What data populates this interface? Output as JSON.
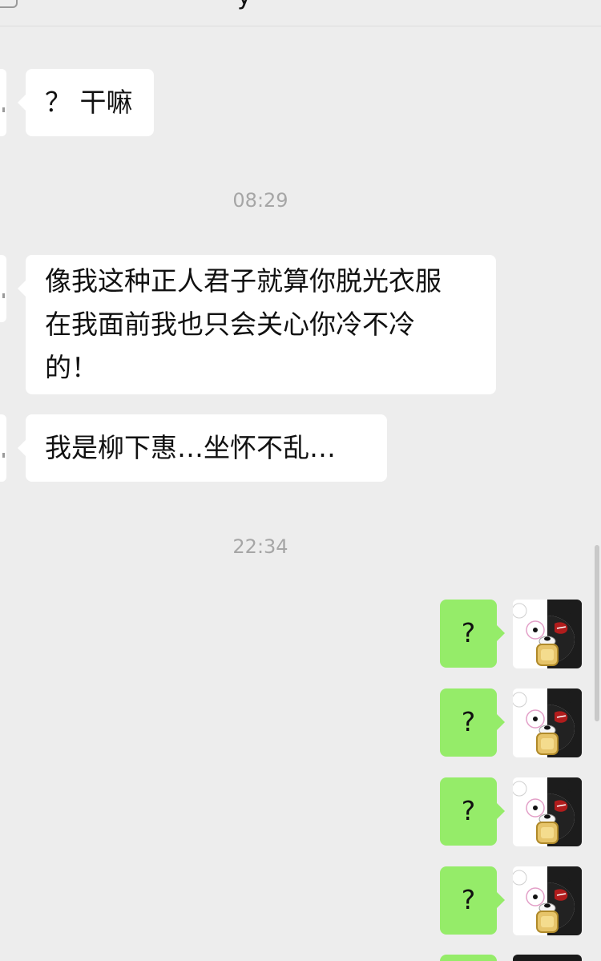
{
  "header": {
    "title_fragment": "y"
  },
  "messages": [
    {
      "side": "left",
      "text": "？ 干嘛"
    },
    {
      "type": "time",
      "text": "08:29"
    },
    {
      "side": "left",
      "lines": [
        "像我这种正人君子就算你脱光衣服",
        "在我面前我也只会关心你冷不冷",
        "的！"
      ]
    },
    {
      "side": "left",
      "text": "我是柳下惠…坐怀不乱…"
    },
    {
      "type": "time",
      "text": "22:34"
    },
    {
      "side": "right",
      "text": "?"
    },
    {
      "side": "right",
      "text": "?"
    },
    {
      "side": "right",
      "text": "?"
    },
    {
      "side": "right",
      "text": "?"
    }
  ],
  "avatar": {
    "icon": "monokuma-avatar-icon"
  },
  "colors": {
    "background": "#ededed",
    "incoming_bubble": "#ffffff",
    "outgoing_bubble": "#95ec69",
    "timestamp_text": "#a6a6a6"
  }
}
